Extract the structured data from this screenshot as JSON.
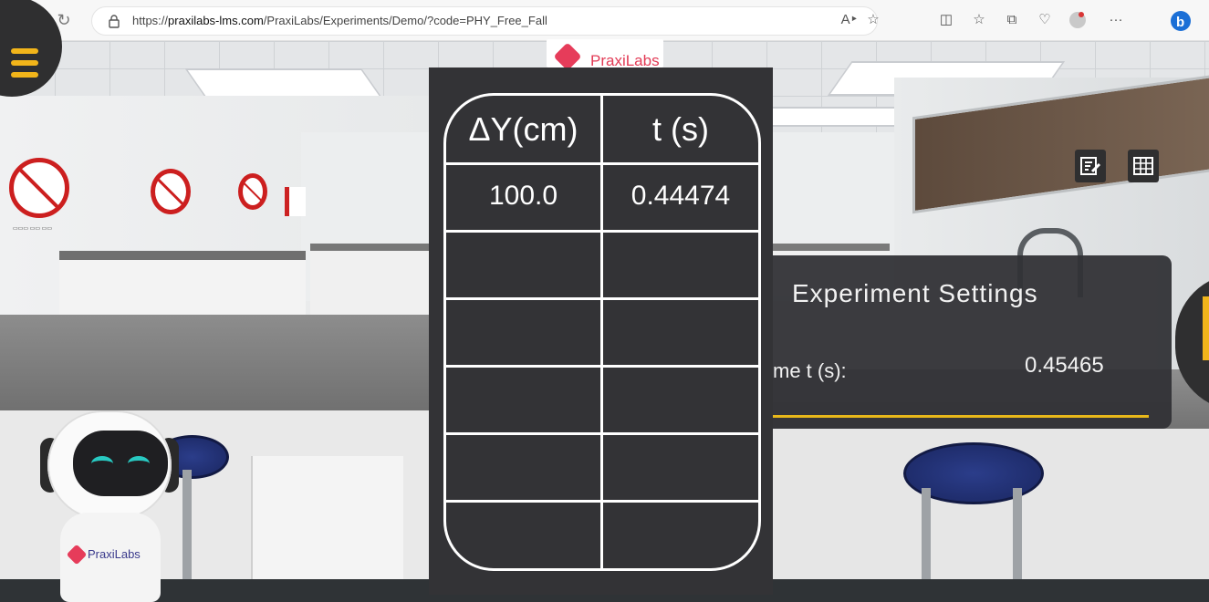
{
  "browser": {
    "url_prefix": "https://",
    "url_domain": "praxilabs-lms.com",
    "url_path": "/PraxiLabs/Experiments/Demo/?code=PHY_Free_Fall",
    "icons": [
      "back-icon",
      "refresh-icon",
      "lock-icon",
      "read-aloud-icon",
      "favorite-icon",
      "split-screen-icon",
      "favorites-icon",
      "collections-icon",
      "browser-health-icon",
      "profile-icon",
      "more-icon",
      "bing-icon"
    ],
    "more_label": "···"
  },
  "logo": {
    "text": "PraxiLabs"
  },
  "robot": {
    "logo_text": "PraxiLabs"
  },
  "data_table": {
    "headers": [
      "ΔY(cm)",
      "t (s)"
    ],
    "rows": [
      [
        "100.0",
        "0.44474"
      ],
      [
        "",
        ""
      ],
      [
        "",
        ""
      ],
      [
        "",
        ""
      ],
      [
        "",
        ""
      ],
      [
        "",
        ""
      ]
    ]
  },
  "settings": {
    "title": "Experiment Settings",
    "label": "me t (s):",
    "value": "0.45465"
  },
  "colors": {
    "panel_bg": "#333336",
    "accent_yellow": "#f2b51a",
    "brand_red": "#e23a55"
  }
}
